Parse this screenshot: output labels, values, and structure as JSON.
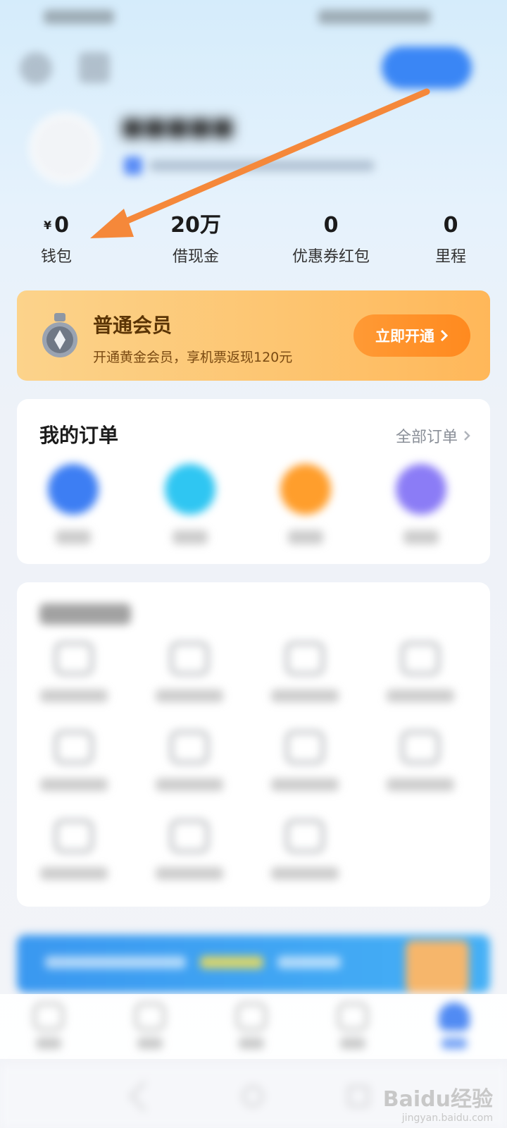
{
  "stats": [
    {
      "currency": "¥",
      "value": "0",
      "label": "钱包"
    },
    {
      "value": "20万",
      "label": "借现金"
    },
    {
      "value": "0",
      "label": "优惠券红包"
    },
    {
      "value": "0",
      "label": "里程"
    }
  ],
  "member": {
    "title": "普通会员",
    "desc": "开通黄金会员，享机票返现120元",
    "button": "立即开通",
    "button_icon": "chevron-right-icon"
  },
  "orders": {
    "title": "我的订单",
    "all_link": "全部订单",
    "items": [
      {
        "icon": "plane-icon",
        "color": "#3d7ef3"
      },
      {
        "icon": "train-icon",
        "color": "#2fc6f2"
      },
      {
        "icon": "hotel-icon",
        "color": "#ff9e2c"
      },
      {
        "icon": "ticket-icon",
        "color": "#8b7cf6"
      }
    ]
  },
  "tools": {
    "rows": 3,
    "items": 11
  },
  "nav": {
    "active_index": 4,
    "items": [
      "home-icon",
      "trip-icon",
      "discover-icon",
      "service-icon",
      "profile-icon"
    ]
  },
  "watermark": {
    "logo": "Baidu经验",
    "url": "jingyan.baidu.com"
  },
  "colors": {
    "accent": "#3a86f5",
    "member_gold": "#fdc46f",
    "member_button": "#ff8a1f",
    "annotation_arrow": "#f5883a"
  }
}
